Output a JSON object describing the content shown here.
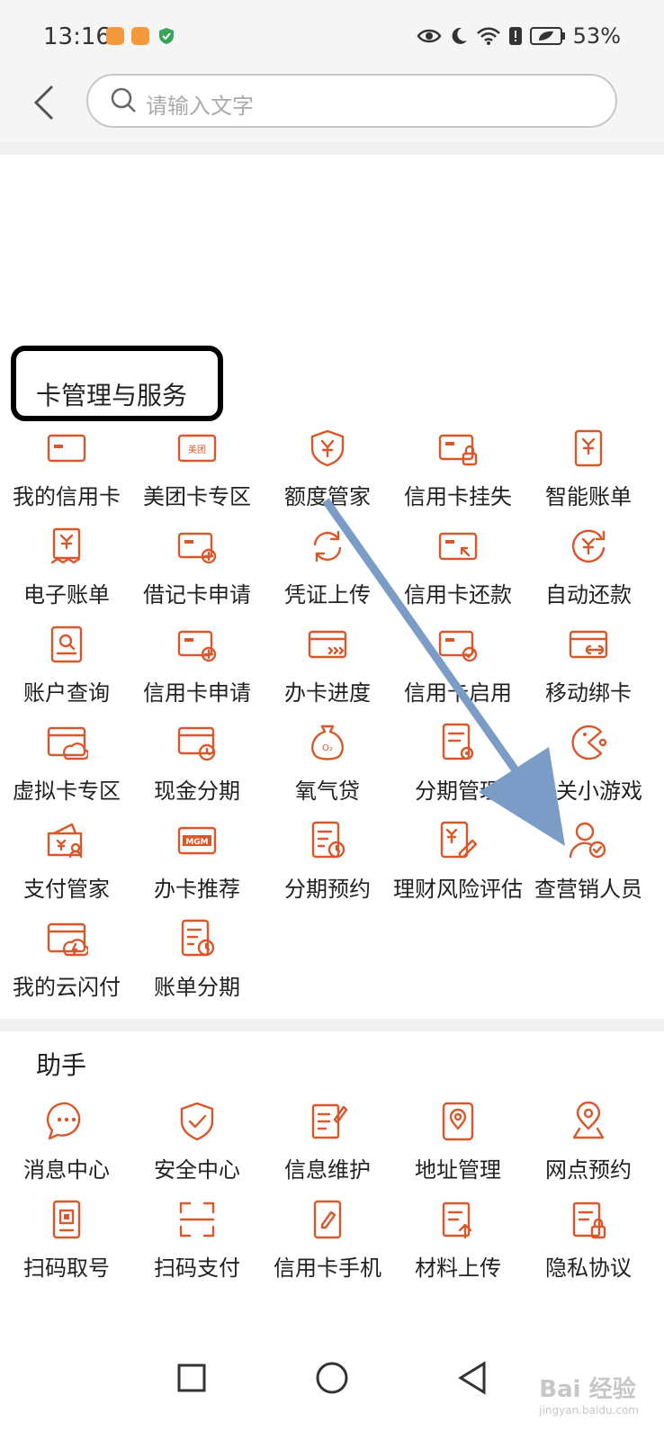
{
  "status_bar": {
    "time": "13:16",
    "battery": "53%"
  },
  "search": {
    "placeholder": "请输入文字"
  },
  "card_section": {
    "title": "卡管理与服务",
    "items": [
      {
        "label": "我的信用卡",
        "icon": "credit-card-icon"
      },
      {
        "label": "美团卡专区",
        "icon": "meituan-card-icon"
      },
      {
        "label": "额度管家",
        "icon": "yuan-shield-icon"
      },
      {
        "label": "信用卡挂失",
        "icon": "card-lock-icon"
      },
      {
        "label": "智能账单",
        "icon": "bill-icon"
      },
      {
        "label": "电子账单",
        "icon": "e-bill-icon"
      },
      {
        "label": "借记卡申请",
        "icon": "card-add-icon"
      },
      {
        "label": "凭证上传",
        "icon": "sync-icon"
      },
      {
        "label": "信用卡还款",
        "icon": "card-repay-icon"
      },
      {
        "label": "自动还款",
        "icon": "auto-repay-icon"
      },
      {
        "label": "账户查询",
        "icon": "account-search-icon"
      },
      {
        "label": "信用卡申请",
        "icon": "card-apply-icon"
      },
      {
        "label": "办卡进度",
        "icon": "card-progress-icon"
      },
      {
        "label": "信用卡启用",
        "icon": "card-activate-icon"
      },
      {
        "label": "移动绑卡",
        "icon": "card-link-icon"
      },
      {
        "label": "虚拟卡专区",
        "icon": "virtual-card-icon"
      },
      {
        "label": "现金分期",
        "icon": "cash-installment-icon"
      },
      {
        "label": "氧气贷",
        "icon": "oxygen-bag-icon"
      },
      {
        "label": "分期管理",
        "icon": "installment-manage-icon"
      },
      {
        "label": "通关小游戏",
        "icon": "pacman-icon"
      },
      {
        "label": "支付管家",
        "icon": "pay-manager-icon"
      },
      {
        "label": "办卡推荐",
        "icon": "mgm-icon"
      },
      {
        "label": "分期预约",
        "icon": "installment-booking-icon"
      },
      {
        "label": "理财风险评估",
        "icon": "risk-assessment-icon"
      },
      {
        "label": "查营销人员",
        "icon": "staff-search-icon"
      },
      {
        "label": "我的云闪付",
        "icon": "quickpass-icon"
      },
      {
        "label": "账单分期",
        "icon": "bill-installment-icon"
      }
    ]
  },
  "helper_section": {
    "title": "助手",
    "items": [
      {
        "label": "消息中心",
        "icon": "chat-icon"
      },
      {
        "label": "安全中心",
        "icon": "shield-check-icon"
      },
      {
        "label": "信息维护",
        "icon": "edit-doc-icon"
      },
      {
        "label": "地址管理",
        "icon": "address-icon"
      },
      {
        "label": "网点预约",
        "icon": "location-pin-icon"
      },
      {
        "label": "扫码取号",
        "icon": "scan-ticket-icon"
      },
      {
        "label": "扫码支付",
        "icon": "scan-icon"
      },
      {
        "label": "信用卡手机",
        "icon": "phone-edit-icon"
      },
      {
        "label": "材料上传",
        "icon": "upload-doc-icon"
      },
      {
        "label": "隐私协议",
        "icon": "privacy-doc-icon"
      }
    ]
  },
  "watermark": {
    "text": "Bai 经验",
    "sub": "jingyan.baidu.com"
  },
  "colors": {
    "icon": "#d9582b",
    "arrow": "#7a9cc6"
  }
}
